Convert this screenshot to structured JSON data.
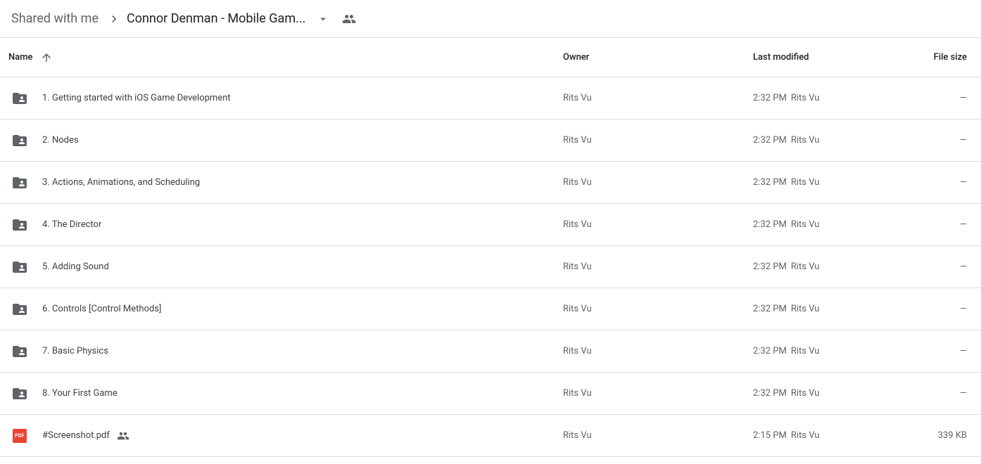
{
  "breadcrumb": {
    "root": "Shared with me",
    "current": "Connor Denman - Mobile Gam..."
  },
  "columns": {
    "name": "Name",
    "owner": "Owner",
    "modified": "Last modified",
    "size": "File size"
  },
  "files": [
    {
      "type": "folder-shared",
      "name": "1. Getting started with iOS Game Development",
      "owner": "Rits Vu",
      "mod_time": "2:32 PM",
      "mod_by": "Rits Vu",
      "size": "—",
      "shared": false
    },
    {
      "type": "folder-shared",
      "name": "2. Nodes",
      "owner": "Rits Vu",
      "mod_time": "2:32 PM",
      "mod_by": "Rits Vu",
      "size": "—",
      "shared": false
    },
    {
      "type": "folder-shared",
      "name": "3. Actions, Animations, and Scheduling",
      "owner": "Rits Vu",
      "mod_time": "2:32 PM",
      "mod_by": "Rits Vu",
      "size": "—",
      "shared": false
    },
    {
      "type": "folder-shared",
      "name": "4. The Director",
      "owner": "Rits Vu",
      "mod_time": "2:32 PM",
      "mod_by": "Rits Vu",
      "size": "—",
      "shared": false
    },
    {
      "type": "folder-shared",
      "name": "5. Adding Sound",
      "owner": "Rits Vu",
      "mod_time": "2:32 PM",
      "mod_by": "Rits Vu",
      "size": "—",
      "shared": false
    },
    {
      "type": "folder-shared",
      "name": "6. Controls [Control Methods]",
      "owner": "Rits Vu",
      "mod_time": "2:32 PM",
      "mod_by": "Rits Vu",
      "size": "—",
      "shared": false
    },
    {
      "type": "folder-shared",
      "name": "7. Basic Physics",
      "owner": "Rits Vu",
      "mod_time": "2:32 PM",
      "mod_by": "Rits Vu",
      "size": "—",
      "shared": false
    },
    {
      "type": "folder-shared",
      "name": "8. Your First Game",
      "owner": "Rits Vu",
      "mod_time": "2:32 PM",
      "mod_by": "Rits Vu",
      "size": "—",
      "shared": false
    },
    {
      "type": "pdf",
      "name": "#Screenshot.pdf",
      "owner": "Rits Vu",
      "mod_time": "2:15 PM",
      "mod_by": "Rits Vu",
      "size": "339 KB",
      "shared": true
    }
  ],
  "icons": {
    "pdf_label": "PDF"
  }
}
